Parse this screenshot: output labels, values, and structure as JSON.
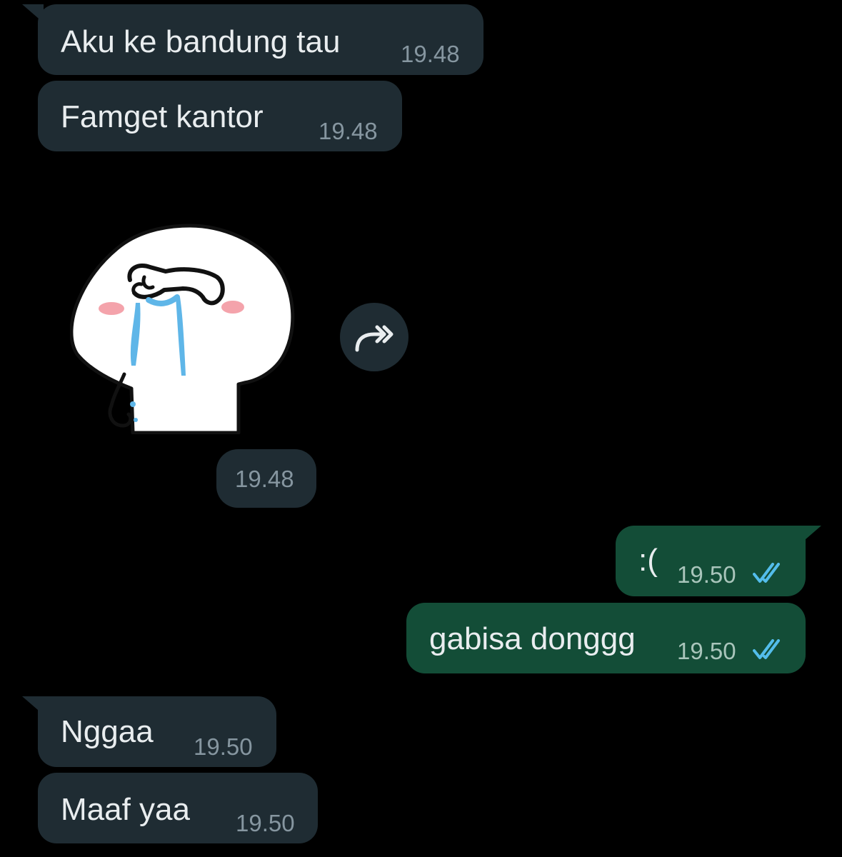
{
  "messages": [
    {
      "text": "Aku ke bandung tau",
      "time": "19.48",
      "direction": "incoming"
    },
    {
      "text": "Famget kantor",
      "time": "19.48",
      "direction": "incoming"
    },
    {
      "sticker": "crying-character-sticker",
      "time": "19.48",
      "direction": "incoming"
    },
    {
      "text": ":(",
      "time": "19.50",
      "direction": "outgoing",
      "status": "read"
    },
    {
      "text": "gabisa donggg",
      "time": "19.50",
      "direction": "outgoing",
      "status": "read"
    },
    {
      "text": "Nggaa",
      "time": "19.50",
      "direction": "incoming"
    },
    {
      "text": "Maaf yaa",
      "time": "19.50",
      "direction": "incoming"
    }
  ],
  "icons": {
    "forward": "forward-icon",
    "read_receipt": "double-check-icon"
  },
  "colors": {
    "background": "#000000",
    "incoming_bubble": "#1f2c33",
    "outgoing_bubble": "#134d37",
    "text": "#e9edef",
    "timestamp": "#8696a0",
    "read_tick": "#53bdeb"
  }
}
